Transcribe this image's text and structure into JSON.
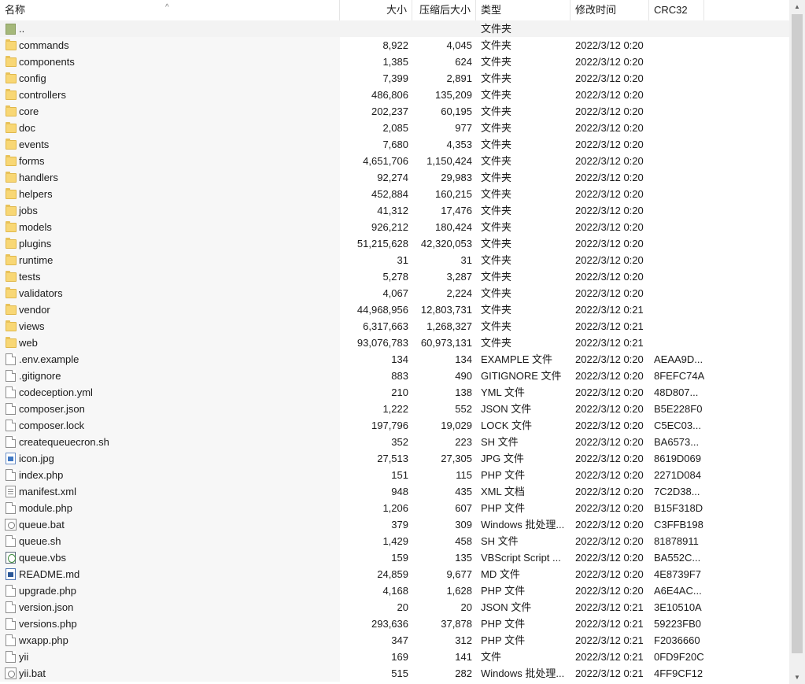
{
  "header": {
    "name": "名称",
    "size": "大小",
    "compressed": "压缩后大小",
    "type": "类型",
    "modified": "修改时间",
    "crc": "CRC32"
  },
  "rows": [
    {
      "name": "..",
      "size": "",
      "csize": "",
      "type": "文件夹",
      "mtime": "",
      "crc": "",
      "icon": "up"
    },
    {
      "name": "commands",
      "size": "8,922",
      "csize": "4,045",
      "type": "文件夹",
      "mtime": "2022/3/12 0:20",
      "crc": "",
      "icon": "folder"
    },
    {
      "name": "components",
      "size": "1,385",
      "csize": "624",
      "type": "文件夹",
      "mtime": "2022/3/12 0:20",
      "crc": "",
      "icon": "folder"
    },
    {
      "name": "config",
      "size": "7,399",
      "csize": "2,891",
      "type": "文件夹",
      "mtime": "2022/3/12 0:20",
      "crc": "",
      "icon": "folder"
    },
    {
      "name": "controllers",
      "size": "486,806",
      "csize": "135,209",
      "type": "文件夹",
      "mtime": "2022/3/12 0:20",
      "crc": "",
      "icon": "folder"
    },
    {
      "name": "core",
      "size": "202,237",
      "csize": "60,195",
      "type": "文件夹",
      "mtime": "2022/3/12 0:20",
      "crc": "",
      "icon": "folder"
    },
    {
      "name": "doc",
      "size": "2,085",
      "csize": "977",
      "type": "文件夹",
      "mtime": "2022/3/12 0:20",
      "crc": "",
      "icon": "folder"
    },
    {
      "name": "events",
      "size": "7,680",
      "csize": "4,353",
      "type": "文件夹",
      "mtime": "2022/3/12 0:20",
      "crc": "",
      "icon": "folder"
    },
    {
      "name": "forms",
      "size": "4,651,706",
      "csize": "1,150,424",
      "type": "文件夹",
      "mtime": "2022/3/12 0:20",
      "crc": "",
      "icon": "folder"
    },
    {
      "name": "handlers",
      "size": "92,274",
      "csize": "29,983",
      "type": "文件夹",
      "mtime": "2022/3/12 0:20",
      "crc": "",
      "icon": "folder"
    },
    {
      "name": "helpers",
      "size": "452,884",
      "csize": "160,215",
      "type": "文件夹",
      "mtime": "2022/3/12 0:20",
      "crc": "",
      "icon": "folder"
    },
    {
      "name": "jobs",
      "size": "41,312",
      "csize": "17,476",
      "type": "文件夹",
      "mtime": "2022/3/12 0:20",
      "crc": "",
      "icon": "folder"
    },
    {
      "name": "models",
      "size": "926,212",
      "csize": "180,424",
      "type": "文件夹",
      "mtime": "2022/3/12 0:20",
      "crc": "",
      "icon": "folder"
    },
    {
      "name": "plugins",
      "size": "51,215,628",
      "csize": "42,320,053",
      "type": "文件夹",
      "mtime": "2022/3/12 0:20",
      "crc": "",
      "icon": "folder"
    },
    {
      "name": "runtime",
      "size": "31",
      "csize": "31",
      "type": "文件夹",
      "mtime": "2022/3/12 0:20",
      "crc": "",
      "icon": "folder"
    },
    {
      "name": "tests",
      "size": "5,278",
      "csize": "3,287",
      "type": "文件夹",
      "mtime": "2022/3/12 0:20",
      "crc": "",
      "icon": "folder"
    },
    {
      "name": "validators",
      "size": "4,067",
      "csize": "2,224",
      "type": "文件夹",
      "mtime": "2022/3/12 0:20",
      "crc": "",
      "icon": "folder"
    },
    {
      "name": "vendor",
      "size": "44,968,956",
      "csize": "12,803,731",
      "type": "文件夹",
      "mtime": "2022/3/12 0:21",
      "crc": "",
      "icon": "folder"
    },
    {
      "name": "views",
      "size": "6,317,663",
      "csize": "1,268,327",
      "type": "文件夹",
      "mtime": "2022/3/12 0:21",
      "crc": "",
      "icon": "folder"
    },
    {
      "name": "web",
      "size": "93,076,783",
      "csize": "60,973,131",
      "type": "文件夹",
      "mtime": "2022/3/12 0:21",
      "crc": "",
      "icon": "folder"
    },
    {
      "name": ".env.example",
      "size": "134",
      "csize": "134",
      "type": "EXAMPLE 文件",
      "mtime": "2022/3/12 0:20",
      "crc": "AEAA9D...",
      "icon": "file"
    },
    {
      "name": ".gitignore",
      "size": "883",
      "csize": "490",
      "type": "GITIGNORE 文件",
      "mtime": "2022/3/12 0:20",
      "crc": "8FEFC74A",
      "icon": "file"
    },
    {
      "name": "codeception.yml",
      "size": "210",
      "csize": "138",
      "type": "YML 文件",
      "mtime": "2022/3/12 0:20",
      "crc": "48D807...",
      "icon": "file"
    },
    {
      "name": "composer.json",
      "size": "1,222",
      "csize": "552",
      "type": "JSON 文件",
      "mtime": "2022/3/12 0:20",
      "crc": "B5E228F0",
      "icon": "file"
    },
    {
      "name": "composer.lock",
      "size": "197,796",
      "csize": "19,029",
      "type": "LOCK 文件",
      "mtime": "2022/3/12 0:20",
      "crc": "C5EC03...",
      "icon": "file"
    },
    {
      "name": "createqueuecron.sh",
      "size": "352",
      "csize": "223",
      "type": "SH 文件",
      "mtime": "2022/3/12 0:20",
      "crc": "BA6573...",
      "icon": "file"
    },
    {
      "name": "icon.jpg",
      "size": "27,513",
      "csize": "27,305",
      "type": "JPG 文件",
      "mtime": "2022/3/12 0:20",
      "crc": "8619D069",
      "icon": "image"
    },
    {
      "name": "index.php",
      "size": "151",
      "csize": "115",
      "type": "PHP 文件",
      "mtime": "2022/3/12 0:20",
      "crc": "2271D084",
      "icon": "file"
    },
    {
      "name": "manifest.xml",
      "size": "948",
      "csize": "435",
      "type": "XML 文档",
      "mtime": "2022/3/12 0:20",
      "crc": "7C2D38...",
      "icon": "xml"
    },
    {
      "name": "module.php",
      "size": "1,206",
      "csize": "607",
      "type": "PHP 文件",
      "mtime": "2022/3/12 0:20",
      "crc": "B15F318D",
      "icon": "file"
    },
    {
      "name": "queue.bat",
      "size": "379",
      "csize": "309",
      "type": "Windows 批处理...",
      "mtime": "2022/3/12 0:20",
      "crc": "C3FFB198",
      "icon": "bat"
    },
    {
      "name": "queue.sh",
      "size": "1,429",
      "csize": "458",
      "type": "SH 文件",
      "mtime": "2022/3/12 0:20",
      "crc": "81878911",
      "icon": "file"
    },
    {
      "name": "queue.vbs",
      "size": "159",
      "csize": "135",
      "type": "VBScript Script ...",
      "mtime": "2022/3/12 0:20",
      "crc": "BA552C...",
      "icon": "vbs"
    },
    {
      "name": "README.md",
      "size": "24,859",
      "csize": "9,677",
      "type": "MD 文件",
      "mtime": "2022/3/12 0:20",
      "crc": "4E8739F7",
      "icon": "word"
    },
    {
      "name": "upgrade.php",
      "size": "4,168",
      "csize": "1,628",
      "type": "PHP 文件",
      "mtime": "2022/3/12 0:20",
      "crc": "A6E4AC...",
      "icon": "file"
    },
    {
      "name": "version.json",
      "size": "20",
      "csize": "20",
      "type": "JSON 文件",
      "mtime": "2022/3/12 0:21",
      "crc": "3E10510A",
      "icon": "file"
    },
    {
      "name": "versions.php",
      "size": "293,636",
      "csize": "37,878",
      "type": "PHP 文件",
      "mtime": "2022/3/12 0:21",
      "crc": "59223FB0",
      "icon": "file"
    },
    {
      "name": "wxapp.php",
      "size": "347",
      "csize": "312",
      "type": "PHP 文件",
      "mtime": "2022/3/12 0:21",
      "crc": "F2036660",
      "icon": "file"
    },
    {
      "name": "yii",
      "size": "169",
      "csize": "141",
      "type": "文件",
      "mtime": "2022/3/12 0:21",
      "crc": "0FD9F20C",
      "icon": "file"
    },
    {
      "name": "yii.bat",
      "size": "515",
      "csize": "282",
      "type": "Windows 批处理...",
      "mtime": "2022/3/12 0:21",
      "crc": "4FF9CF12",
      "icon": "bat"
    }
  ]
}
